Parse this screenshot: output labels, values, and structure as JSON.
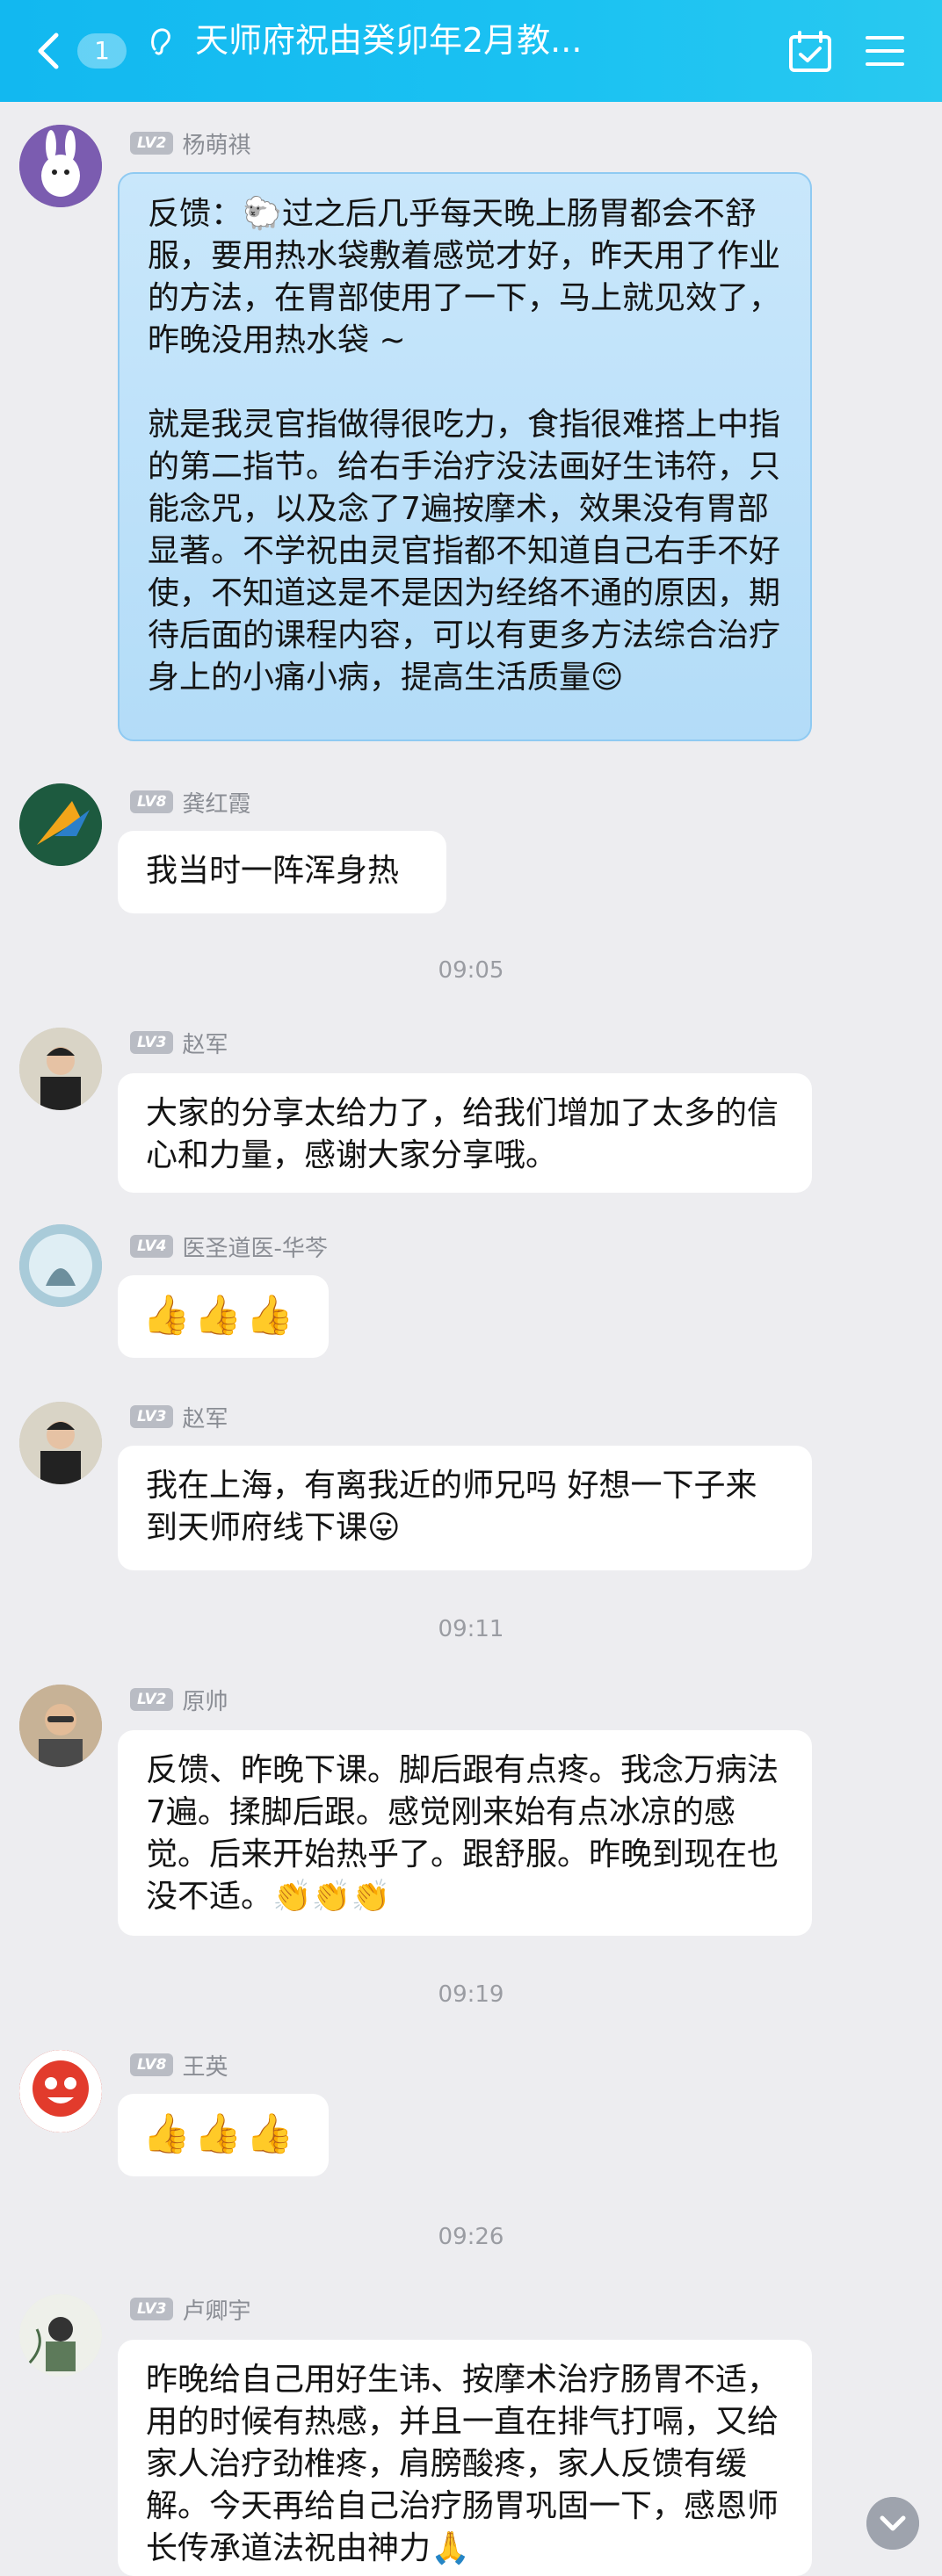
{
  "header": {
    "unread_count": "1",
    "title": "天师府祝由癸卯年2月教..."
  },
  "messages": [
    {
      "level": "LV2",
      "name": "杨萌祺",
      "text": "反馈：🐑过之后几乎每天晚上肠胃都会不舒服，要用热水袋敷着感觉才好，昨天用了作业的方法，在胃部使用了一下，马上就见效了，昨晚没用热水袋 ~\n\n就是我灵官指做得很吃力，食指很难搭上中指的第二指节。给右手治疗没法画好生讳符，只能念咒，以及念了7遍按摩术，效果没有胃部显著。不学祝由灵官指都不知道自己右手不好使，不知道这是不是因为经络不通的原因，期待后面的课程内容，可以有更多方法综合治疗身上的小痛小病，提高生活质量😊"
    },
    {
      "level": "LV8",
      "name": "龚红霞",
      "text": "我当时一阵浑身热"
    },
    {
      "level": "LV3",
      "name": "赵军",
      "text": "大家的分享太给力了，给我们增加了太多的信心和力量，感谢大家分享哦。"
    },
    {
      "level": "LV4",
      "name": "医圣道医-华芩",
      "text": "👍👍👍"
    },
    {
      "level": "LV3",
      "name": "赵军",
      "text": "我在上海，有离我近的师兄吗 好想一下子来到天师府线下课😛"
    },
    {
      "level": "LV2",
      "name": "原帅",
      "text": "反馈、昨晚下课。脚后跟有点疼。我念万病法7遍。揉脚后跟。感觉刚来始有点冰凉的感觉。后来开始热乎了。跟舒服。昨晚到现在也没不适。👏👏👏"
    },
    {
      "level": "LV8",
      "name": "王英",
      "text": "👍👍👍"
    },
    {
      "level": "LV3",
      "name": "卢卿宇",
      "text": "昨晚给自己用好生讳、按摩术治疗肠胃不适，用的时候有热感，并且一直在排气打嗝，又给家人治疗劲椎疼，肩膀酸疼，家人反馈有缓解。今天再给自己治疗肠胃巩固一下，感恩师长传承道法祝由神力🙏"
    }
  ],
  "timestamps": [
    "09:05",
    "09:11",
    "09:19",
    "09:26"
  ],
  "colors": {
    "header": "#1bc2f2",
    "background": "#ededf0",
    "bubble": "#ffffff",
    "bubble_highlight": "#b3dcf8"
  }
}
